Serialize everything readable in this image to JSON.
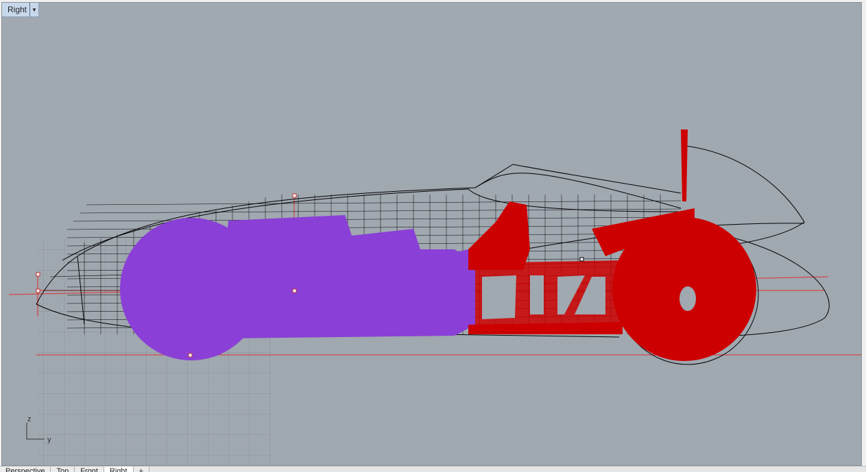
{
  "viewport": {
    "title": "Right",
    "dropdown_icon": "chevron-down-icon",
    "background_color": "#a0a8b0",
    "axis_labels": {
      "vertical": "z",
      "horizontal": "y"
    }
  },
  "model": {
    "wireframe_color": "#000000",
    "rear_mesh_color": "#8a3fd6",
    "front_mesh_color": "#cc0000",
    "guide_line_color": "#e03030"
  },
  "tabs": [
    "Perspective",
    "Top",
    "Front",
    "Right",
    "+"
  ]
}
